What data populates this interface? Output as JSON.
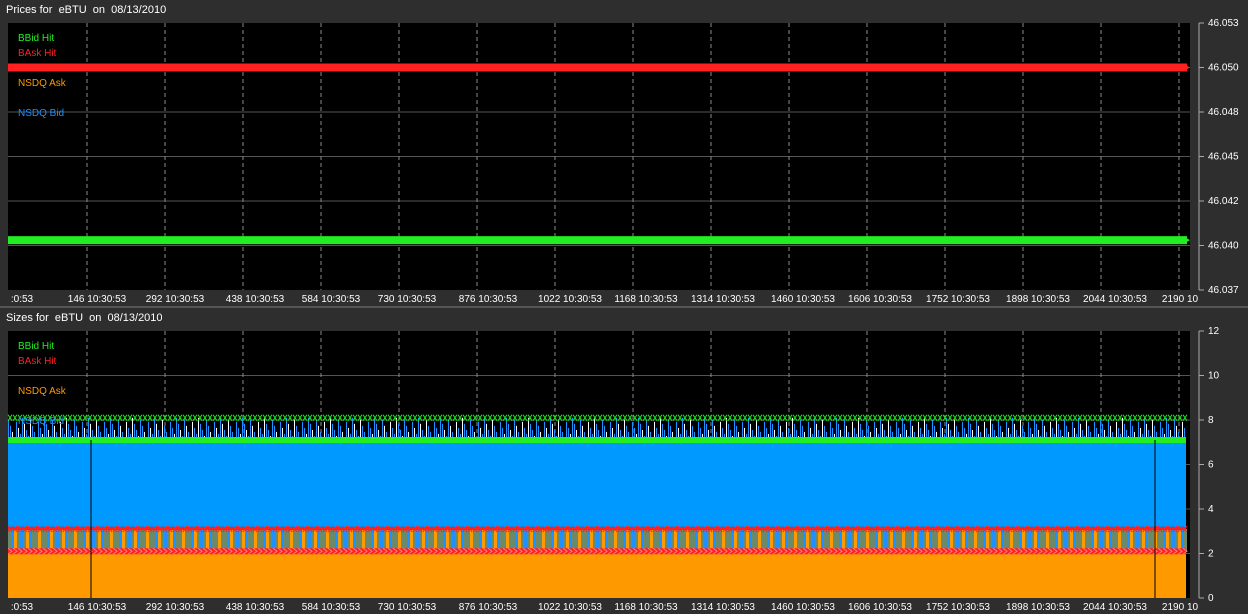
{
  "chart_data": [
    {
      "type": "line",
      "title": "Prices for  eBTU  on  08/13/2010",
      "legend": [
        {
          "label": "BBid Hit",
          "color": "#22ee22"
        },
        {
          "label": "BAsk Hit",
          "color": "#ff2020"
        },
        {
          "label": "NSDQ Ask",
          "color": "#ff9900"
        },
        {
          "label": "NSDQ Bid",
          "color": "#1e90ff"
        }
      ],
      "y_ticks": [
        "46.053",
        "46.050",
        "46.048",
        "46.045",
        "46.042",
        "46.040",
        "46.037"
      ],
      "ylim": [
        46.0375,
        46.0525
      ],
      "x_ticks": [
        ":0:53",
        "146 10:30:53",
        "292 10:30:53",
        "438 10:30:53",
        "584 10:30:53",
        "730 10:30:53",
        "876 10:30:53",
        "1022 10:30:53",
        "1168 10:30:53",
        "1314 10:30:53",
        "1460 10:30:53",
        "1606 10:30:53",
        "1752 10:30:53",
        "1898 10:30:53",
        "2044 10:30:53",
        "2190 10"
      ],
      "series": [
        {
          "name": "BAsk Hit",
          "color": "#ff2020",
          "value": 46.05
        },
        {
          "name": "BBid Hit",
          "color": "#22ee22",
          "value": 46.0403
        }
      ],
      "grid": true,
      "legend_placement": "top-left"
    },
    {
      "type": "area",
      "title": "Sizes for  eBTU  on  08/13/2010",
      "legend": [
        {
          "label": "BBid Hit",
          "color": "#22ee22"
        },
        {
          "label": "BAsk Hit",
          "color": "#ff2020"
        },
        {
          "label": "NSDQ Ask",
          "color": "#ff9900"
        },
        {
          "label": "NSDQ Bid",
          "color": "#1e90ff"
        }
      ],
      "y_ticks": [
        "12",
        "10",
        "8",
        "6",
        "4",
        "2",
        "0"
      ],
      "ylim": [
        0,
        12
      ],
      "x_ticks": [
        ":0:53",
        "146 10:30:53",
        "292 10:30:53",
        "438 10:30:53",
        "584 10:30:53",
        "730 10:30:53",
        "876 10:30:53",
        "1022 10:30:53",
        "1168 10:30:53",
        "1314 10:30:53",
        "1460 10:30:53",
        "1606 10:30:53",
        "1752 10:30:53",
        "1898 10:30:53",
        "2044 10:30:53",
        "2190 10"
      ],
      "series": [
        {
          "name": "NSDQ Ask",
          "color": "#ff9900",
          "value": 2
        },
        {
          "name": "NSDQ Bid",
          "color": "#0099ff",
          "value": 7
        },
        {
          "name": "BBid Hit",
          "color": "#22ee22",
          "value": 7.1
        },
        {
          "name": "BBid Hit",
          "color": "#22ee22",
          "value": 8.1
        },
        {
          "name": "BAsk Hit",
          "color": "#ff2020",
          "value": 3.1
        },
        {
          "name": "BAsk Hit",
          "color": "#ff2020",
          "value": 2.1
        }
      ],
      "grid": true,
      "legend_placement": "top-left"
    }
  ]
}
